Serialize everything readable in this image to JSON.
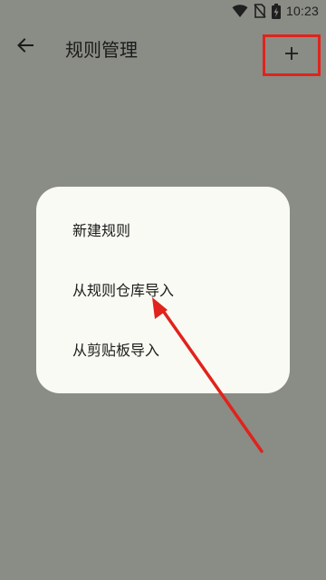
{
  "status_bar": {
    "time": "10:23",
    "icons": [
      "wifi-icon",
      "no-sim-icon",
      "battery-charging-icon"
    ]
  },
  "app_bar": {
    "back_icon": "arrow-left-icon",
    "title": "规则管理",
    "add_icon": "plus-icon"
  },
  "menu": {
    "items": [
      {
        "label": "新建规则"
      },
      {
        "label": "从规则仓库导入"
      },
      {
        "label": "从剪贴板导入"
      }
    ]
  },
  "colors": {
    "scrim_background": "#8a8c86",
    "menu_background": "#f9faf3",
    "annotation_red": "#e0231c"
  }
}
